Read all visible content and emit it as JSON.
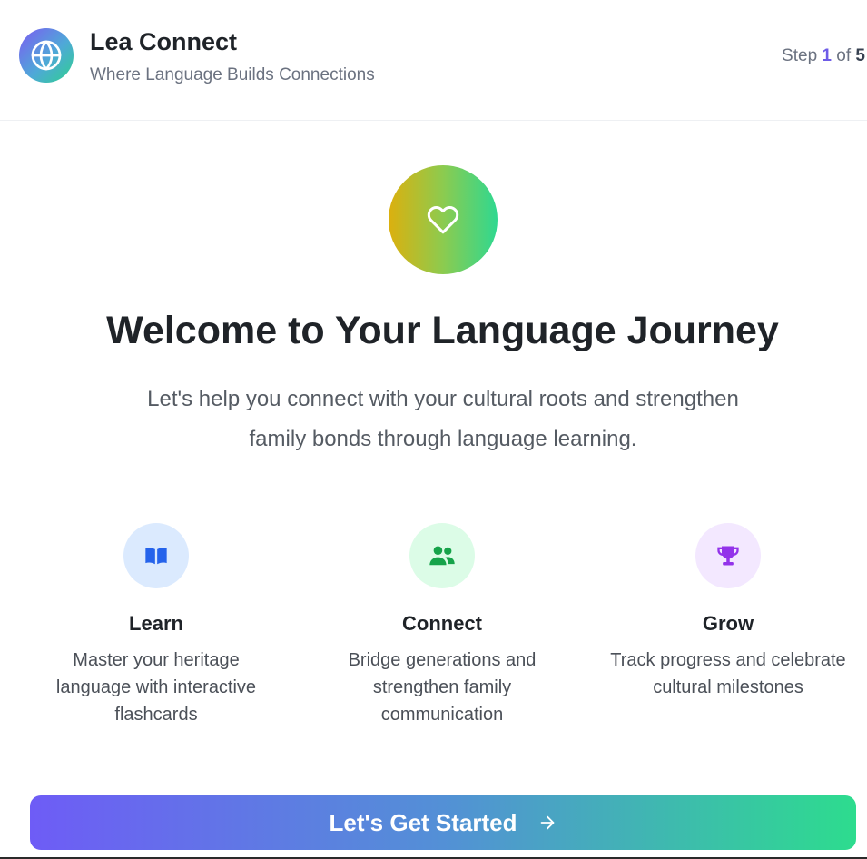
{
  "header": {
    "app_title": "Lea Connect",
    "app_subtitle": "Where Language Builds Connections",
    "logo_icon": "globe-icon",
    "step_prefix": "Step",
    "step_current": "1",
    "step_separator": "of",
    "step_total": "5"
  },
  "hero": {
    "icon": "heart-icon",
    "title": "Welcome to Your Language Journey",
    "intro": "Let's help you connect with your cultural roots and strengthen family bonds through language learning."
  },
  "features": [
    {
      "title": "Learn",
      "description": "Master your heritage language with interactive flashcards",
      "icon": "book-icon",
      "icon_color": "#2563eb",
      "bg_color": "#dbeafe"
    },
    {
      "title": "Connect",
      "description": "Bridge generations and strengthen family communication",
      "icon": "users-icon",
      "icon_color": "#16a34a",
      "bg_color": "#dcfce7"
    },
    {
      "title": "Grow",
      "description": "Track progress and celebrate cultural milestones",
      "icon": "trophy-icon",
      "icon_color": "#9333ea",
      "bg_color": "#f3e8ff"
    }
  ],
  "cta": {
    "label": "Let's Get Started",
    "icon": "arrow-right-icon"
  },
  "colors": {
    "accent_purple": "#6e5cf6",
    "accent_green": "#2ddc8e",
    "hero_gold": "#dcb00e"
  }
}
